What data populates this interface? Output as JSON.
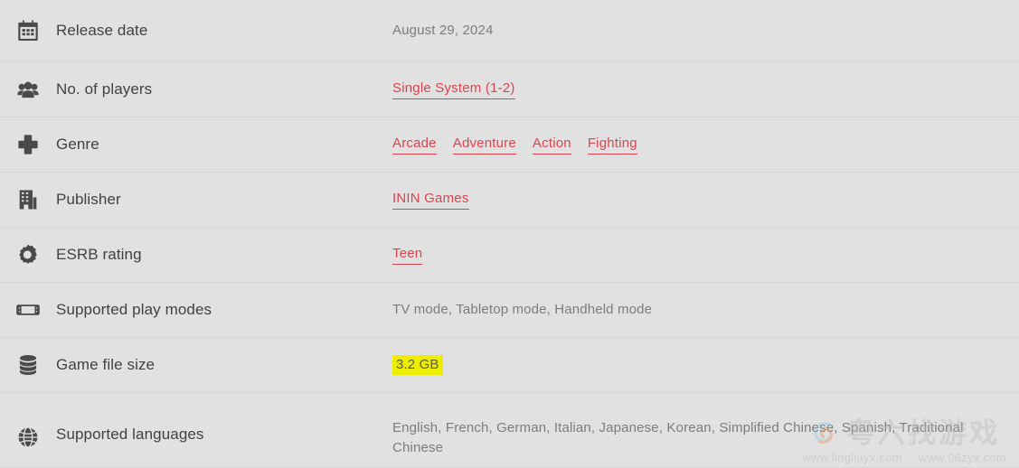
{
  "page": {
    "title": "Game specifications table",
    "background_color": "#e1e1e1",
    "link_color": "#d94450",
    "label_color": "#414141",
    "value_color": "#7c7c7c",
    "highlight_color": "#eded00"
  },
  "rows": [
    {
      "icon": "calendar-icon",
      "label": "Release date",
      "value_type": "text",
      "value": "August 29, 2024"
    },
    {
      "icon": "players-icon",
      "label": "No. of players",
      "value_type": "links",
      "links": [
        "Single System (1-2)"
      ]
    },
    {
      "icon": "dpad-icon",
      "label": "Genre",
      "value_type": "links",
      "links": [
        "Arcade",
        "Adventure",
        "Action",
        "Fighting"
      ]
    },
    {
      "icon": "building-icon",
      "label": "Publisher",
      "value_type": "links",
      "links": [
        "ININ Games"
      ]
    },
    {
      "icon": "gear-icon",
      "label": "ESRB rating",
      "value_type": "links",
      "links": [
        "Teen"
      ]
    },
    {
      "icon": "handheld-console-icon",
      "label": "Supported play modes",
      "value_type": "text",
      "value": "TV mode, Tabletop mode, Handheld mode"
    },
    {
      "icon": "database-icon",
      "label": "Game file size",
      "value_type": "highlight",
      "value": "3.2 GB"
    },
    {
      "icon": "globe-icon",
      "label": "Supported languages",
      "value_type": "text",
      "value": "English, French, German, Italian, Japanese, Korean, Simplified Chinese, Spanish, Traditional Chinese"
    }
  ],
  "watermark": {
    "brand_cn": "粤六找游戏",
    "url_primary": "www.lingliuyx.com",
    "url_secondary": "www.06zyx.com"
  }
}
